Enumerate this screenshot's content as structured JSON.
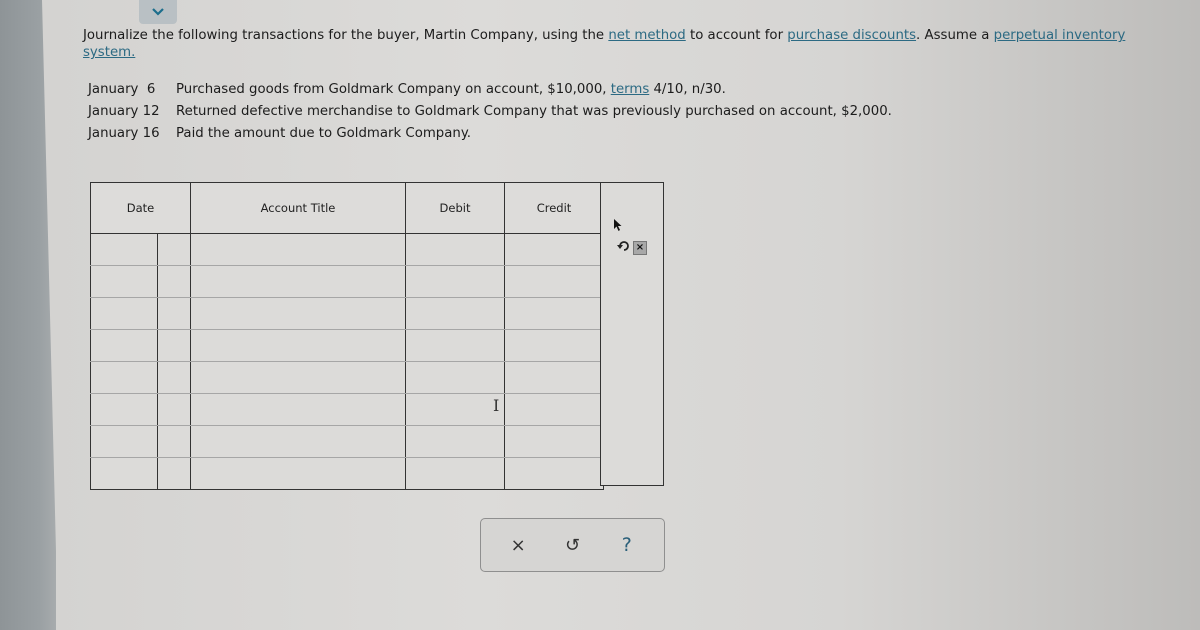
{
  "header": {
    "toggle_icon": "chevron-down-icon"
  },
  "instructions": {
    "part1": "Journalize the following transactions for the buyer, Martin Company, using the ",
    "link1": "net method",
    "part2": " to account for ",
    "link2": "purchase discounts",
    "part3": ". Assume a ",
    "link3": "perpetual inventory system.",
    "part4": ""
  },
  "transactions": [
    {
      "date": "January  6",
      "pre": "Purchased goods from Goldmark Company on account, $10,000, ",
      "link": "terms",
      "post": " 4/10, n/30."
    },
    {
      "date": "January 12",
      "pre": "Returned defective merchandise to Goldmark Company that was previously purchased on account, $2,000.",
      "link": "",
      "post": ""
    },
    {
      "date": "January 16",
      "pre": "Paid the amount due to Goldmark Company.",
      "link": "",
      "post": ""
    }
  ],
  "journal": {
    "columns": {
      "date": "Date",
      "account_title": "Account Title",
      "debit": "Debit",
      "credit": "Credit"
    },
    "rows": [
      {
        "month": "",
        "day": "",
        "account": "",
        "debit": "",
        "credit": ""
      },
      {
        "month": "",
        "day": "",
        "account": "",
        "debit": "",
        "credit": ""
      },
      {
        "month": "",
        "day": "",
        "account": "",
        "debit": "",
        "credit": ""
      },
      {
        "month": "",
        "day": "",
        "account": "",
        "debit": "",
        "credit": ""
      },
      {
        "month": "",
        "day": "",
        "account": "",
        "debit": "",
        "credit": ""
      },
      {
        "month": "",
        "day": "",
        "account": "",
        "debit": "",
        "credit": ""
      },
      {
        "month": "",
        "day": "",
        "account": "",
        "debit": "",
        "credit": ""
      },
      {
        "month": "",
        "day": "",
        "account": "",
        "debit": "",
        "credit": ""
      }
    ],
    "row_actions": {
      "undo_icon": "undo-icon",
      "delete_glyph": "×"
    }
  },
  "controls": {
    "clear_glyph": "×",
    "reset_glyph": "↺",
    "help_glyph": "?"
  }
}
